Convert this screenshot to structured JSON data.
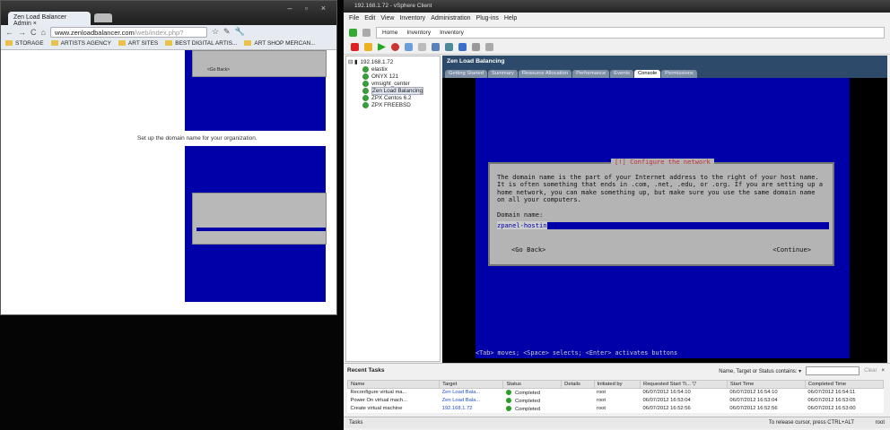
{
  "browser": {
    "tab_title": "Zen Load Balancer Admin",
    "url_host": "www.zenloadbalancer.com",
    "url_path": "/web/index.php?",
    "bookmarks": [
      "STORAGE",
      "ARTISTS AGENCY",
      "ART SITES",
      "BEST DIGITAL ARTIS...",
      "ART SHOP MERCAN..."
    ],
    "content_text": "Set up the domain name for your organization.",
    "img_button": "<Go Back>"
  },
  "vsphere": {
    "title": "192.168.1.72 - vSphere Client",
    "menu": [
      "File",
      "Edit",
      "View",
      "Inventory",
      "Administration",
      "Plug-ins",
      "Help"
    ],
    "breadcrumb": [
      "Home",
      "Inventory",
      "Inventory"
    ],
    "tree": {
      "host": "192.168.1.72",
      "vms": [
        "elastix",
        "ONYX 121",
        "vmsight_center",
        "Zen Load Balancing",
        "ZPX Centos 6.2",
        "ZPX FREEBSD"
      ]
    },
    "panel_title": "Zen Load Balancing",
    "tabs": [
      "Getting Started",
      "Summary",
      "Resource Allocation",
      "Performance",
      "Events",
      "Console",
      "Permissions"
    ],
    "console": {
      "dialog_title": "[!] Configure the network",
      "body": "The domain name is the part of your Internet address to the right of your host name.  It is often something that ends in .com, .net, .edu, or .org.  If you are setting up a home network, you can make something up, but make sure you use the same domain name on all your computers.",
      "label": "Domain name:",
      "value": "zpanel-hostin",
      "back": "<Go Back>",
      "continue": "<Continue>",
      "hint": "<Tab> moves; <Space> selects; <Enter> activates buttons"
    },
    "recent_tasks": {
      "title": "Recent Tasks",
      "filter_label": "Name, Target or Status contains: ▾",
      "clear": "Clear",
      "columns": [
        "Name",
        "Target",
        "Status",
        "Details",
        "Initiated by",
        "Requested Start Ti... ▽",
        "Start Time",
        "Completed Time"
      ],
      "rows": [
        [
          "Reconfigure virtual ma...",
          "Zen Load Bala...",
          "Completed",
          "",
          "root",
          "06/07/2012 16:54:10",
          "06/07/2012 16:54:10",
          "06/07/2012 16:54:11"
        ],
        [
          "Power On virtual mach...",
          "Zen Load Bala...",
          "Completed",
          "",
          "root",
          "06/07/2012 16:53:04",
          "06/07/2012 16:53:04",
          "06/07/2012 16:53:05"
        ],
        [
          "Create virtual machine",
          "192.168.1.72",
          "Completed",
          "",
          "root",
          "06/07/2012 16:52:56",
          "06/07/2012 16:52:56",
          "06/07/2012 16:53:00"
        ]
      ]
    },
    "status": {
      "tasks": "Tasks",
      "release": "To release cursor, press CTRL+ALT",
      "user": "root"
    }
  }
}
